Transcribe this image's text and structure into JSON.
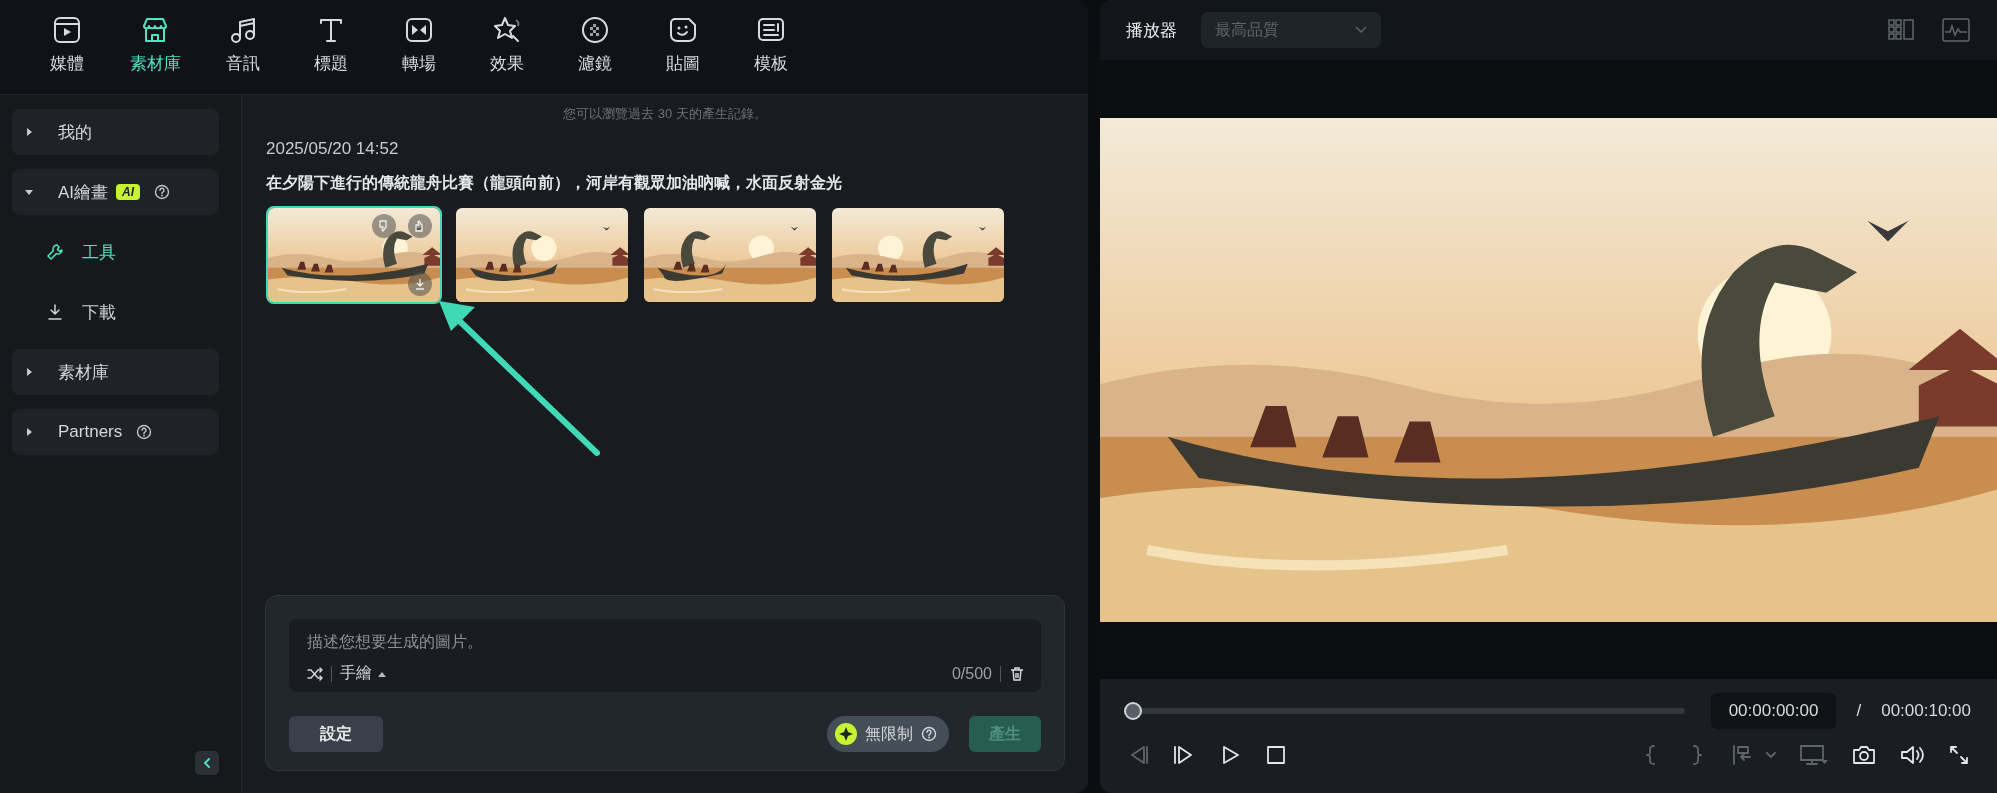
{
  "toolbar": {
    "tabs": [
      {
        "label": "媒體",
        "selected": false
      },
      {
        "label": "素材庫",
        "selected": true
      },
      {
        "label": "音訊",
        "selected": false
      },
      {
        "label": "標題",
        "selected": false
      },
      {
        "label": "轉場",
        "selected": false
      },
      {
        "label": "效果",
        "selected": false
      },
      {
        "label": "濾鏡",
        "selected": false
      },
      {
        "label": "貼圖",
        "selected": false
      },
      {
        "label": "模板",
        "selected": false
      }
    ]
  },
  "sidebar": {
    "items": [
      {
        "label": "我的",
        "expanded": false
      },
      {
        "label": "AI繪畫",
        "expanded": true,
        "badge": "AI",
        "help": true,
        "children": [
          {
            "label": "工具",
            "selected": true
          },
          {
            "label": "下載",
            "selected": false
          }
        ]
      },
      {
        "label": "素材庫",
        "expanded": false
      },
      {
        "label": "Partners",
        "expanded": false,
        "help": true
      }
    ]
  },
  "history": {
    "notice": "您可以瀏覽過去 30 天的產生記錄。",
    "entries": [
      {
        "time": "2025/05/20 14:52",
        "prompt": "在夕陽下進行的傳統龍舟比賽（龍頭向前），河岸有觀眾加油吶喊，水面反射金光",
        "images": [
          {
            "kind": "picture",
            "selected": true
          },
          {
            "kind": "picture",
            "selected": false
          },
          {
            "kind": "picture",
            "selected": false
          },
          {
            "kind": "picture",
            "selected": false
          }
        ]
      }
    ]
  },
  "composer": {
    "placeholder": "描述您想要生成的圖片。",
    "style": "手繪",
    "counter": "0/500",
    "settings_button": "設定",
    "credits": "無限制",
    "generate_button": {
      "label": "產生",
      "disabled": true
    }
  },
  "player": {
    "title": "播放器",
    "quality": "最高品質",
    "preview": {
      "kind": "picture"
    },
    "progress": {
      "level": 0
    },
    "current_time": "00:00:00:00",
    "separator": "/",
    "total_time": "00:00:10:00"
  }
}
